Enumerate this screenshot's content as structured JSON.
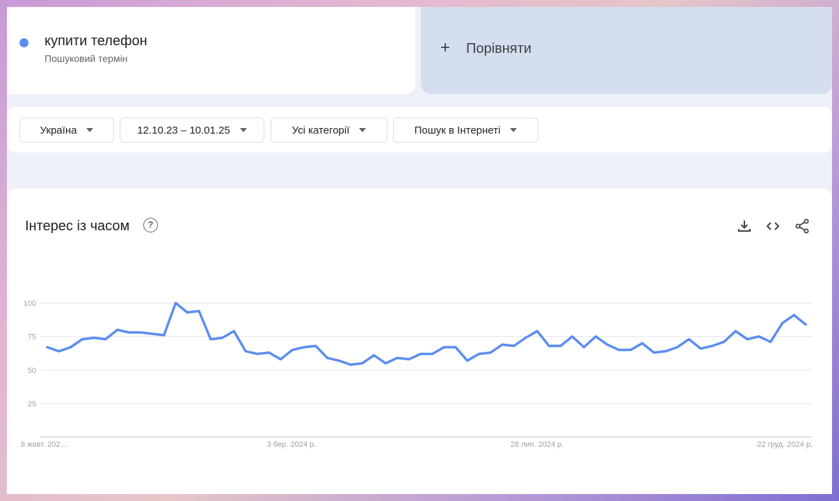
{
  "term": {
    "title": "купити телефон",
    "subtitle": "Пошуковий термін",
    "dot_color": "#5b8def"
  },
  "compare": {
    "plus": "+",
    "label": "Порівняти"
  },
  "filters": [
    {
      "label": "Україна"
    },
    {
      "label": "12.10.23 – 10.01.25"
    },
    {
      "label": "Усі категорії"
    },
    {
      "label": "Пошук в Інтернеті"
    }
  ],
  "chart_section": {
    "title": "Інтерес із часом",
    "help_icon": "?",
    "tools": [
      "download-icon",
      "embed-icon",
      "share-icon"
    ]
  },
  "chart_data": {
    "type": "line",
    "title": "Інтерес із часом",
    "ylim": [
      0,
      100
    ],
    "yticks": [
      "100",
      "75",
      "50",
      "25"
    ],
    "xtick_labels": [
      "8 жовт. 202…",
      "3 бер. 2024 р.",
      "28 лип. 2024 р.",
      "22 груд. 2024 р."
    ],
    "grid": true,
    "series": [
      {
        "color": "#5b8def",
        "values": [
          67,
          64,
          67,
          73,
          74,
          73,
          80,
          78,
          78,
          77,
          76,
          100,
          93,
          94,
          73,
          74,
          79,
          64,
          62,
          63,
          58,
          65,
          67,
          68,
          59,
          57,
          54,
          55,
          61,
          55,
          59,
          58,
          62,
          62,
          67,
          67,
          57,
          62,
          63,
          69,
          68,
          74,
          79,
          68,
          68,
          75,
          67,
          75,
          69,
          65,
          65,
          70,
          63,
          64,
          67,
          73,
          66,
          68,
          71,
          79,
          73,
          75,
          71,
          85,
          91,
          84
        ]
      }
    ]
  }
}
